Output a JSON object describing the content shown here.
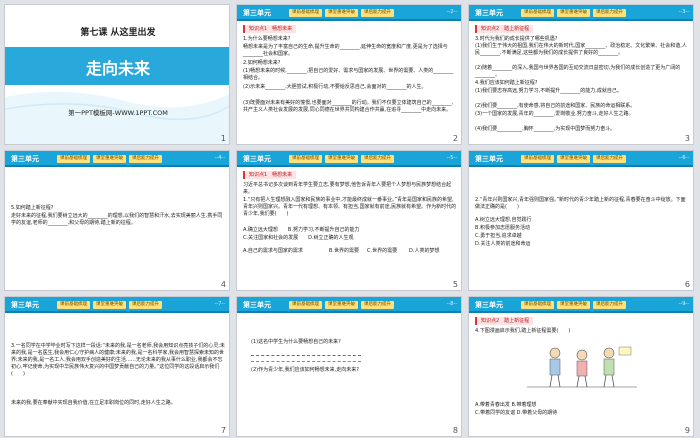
{
  "slides": [
    {
      "num": "1",
      "chapter_title": "第七课 从这里出发",
      "main_title": "走向未来",
      "brand": "第一PPT模板网-WWW.1PPT.COM"
    },
    {
      "num": "2",
      "unit": "第三单元",
      "tabs": [
        "课前基础梳理",
        "课堂重难突破",
        "课后能力提升"
      ],
      "page": "--2--",
      "section": "知识点1　畅想未来",
      "lines": [
        "1.为什么要畅想未来?",
        "畅想未来是为了丰富自己的生命,提升生命的________,延伸生命的宽度和广度,更是为了选择与________社会和国家。",
        "2.如何畅想未来?",
        "(1)畅想未来的时候,________,把自己的爱好、需求与国家的发展、世界的需要、人类的________相结合。",
        "(2)示未来________,大胆尝试,积极行动,不要给反思自己,会面对的________的人生。",
        "(3)既要面对未来有美好的憧憬,也要面对________的行动。我们不仅要立体建筑自己的________,共产主义人类社会发展的发展,同心同德在世界共同构建合作共赢,在追寻________中走向未来。"
      ]
    },
    {
      "num": "3",
      "unit": "第三单元",
      "tabs": [
        "课前基础梳理",
        "课堂重难突破",
        "课后能力提升"
      ],
      "page": "--3--",
      "section": "知识点2　踏上新征程",
      "lines": [
        "3.时代为我们的成长提供了哪些机遇?",
        "(1)我们生于伟大的祖国,我们在伟大的新时代,国家________、政治稳定、文化繁荣、社会和谐,人民________,不断满足,这些都为我们的成长提供了良好的________。",
        "(2)随着________的深入,我国与世界各国的互动交流日益密切,为我们的成长创造了更为广阔的________。",
        "4.我们应该如何踏上新征程?",
        "(1)我们要志存高远,努力学习,不断提升________的能力,成就自己。",
        "(2)我们要________,有使命感,将自己的前途和国家、民族的命运相联系。",
        "(3)一个国家的发展,青年的________,爱岗敬业,努力奋斗,走好人生之路。",
        "(4)我们要__________,胸怀________,为实现中国梦而努力奋斗。"
      ]
    },
    {
      "num": "4",
      "unit": "第三单元",
      "tabs": [
        "课前基础梳理",
        "课堂重难突破",
        "课后能力提升"
      ],
      "page": "--4--",
      "lines": [
        "5.如何踏上新征程?",
        "走好未来的征程,我们要树立远大的________的理想,以我们的智慧和汗水,去实现美丽人生,携手同学的友谊,老师的________,和父母的期待,踏上新的征程。"
      ]
    },
    {
      "num": "5",
      "unit": "第三单元",
      "tabs": [
        "课前基础梳理",
        "课堂重难突破",
        "课后能力提升"
      ],
      "page": "--5--",
      "section": "知识点1　畅想未来",
      "lines": [
        "习近平总书记多次谈到青年学生要立志,要有梦想,他告诉青年人要把个人梦想与民族梦想结合起来。",
        "1.“只有把人生理想融入国家和民族的事业中,才能最终成就一番事业。”青年是国家和民族的希望,青年兴则国家兴。青年一代有理想、有本领、有担当,国家就有前途,民族就有希望。作为新时代的青少年,我们要(　　)",
        "A.确立远大理想　　B.努力学习,不断提升自己的能力",
        "C.关注国家和社会的发展　　D.树立正确的人生观"
      ],
      "options": [
        "A.自己的需求与国家的需求",
        "B.世界的需要",
        "C.世界的需要",
        "D.人类的梦想"
      ]
    },
    {
      "num": "6",
      "unit": "第三单元",
      "tabs": [
        "课前基础梳理",
        "课堂重难突破",
        "课后能力提升"
      ],
      "page": "--6--",
      "lines": [
        "2.“青年兴则国家兴,青年强则国家强。”新时代的青少年踏上新的征程,青春要在奋斗中绽放。下面做法正确的是(　　)",
        "A.树立远大理想,自觉践行",
        "B.积极参加志愿服务活动",
        "C.勇于担当,追求卓越",
        "D.关注人类的前途和命运"
      ]
    },
    {
      "num": "7",
      "unit": "第三单元",
      "tabs": [
        "课前基础梳理",
        "课堂重难突破",
        "课后能力提升"
      ],
      "page": "--7--",
      "lines": [
        "3.一名同学在中学毕业时写下这样一段话:“未来的我,是一名老师,我会用知识点亮孩子们的心灵;未来的我,是一名医生,我会用仁心守护病人的健康;未来的我,是一名科学家,我会用智慧探索未知的世界;未来的我,是一名工人,我会用双手创造美好的生活……无论未来的我从事什么职业,我都会不忘初心,牢记使命,为实现中华民族伟大复兴的中国梦贡献自己的力量。”这位同学的这段话启示我们(　　)",
        "未来的我,要在奉献中实现自我价值,在立足本职岗位的同时,走好人生之路。"
      ]
    },
    {
      "num": "8",
      "unit": "第三单元",
      "tabs": [
        "课前基础梳理",
        "课堂重难突破",
        "课后能力提升"
      ],
      "page": "--8--",
      "lines": [
        "(1)这名中学生为什么要畅想自己的未来?",
        "(2)作为青少年,我们应该如何畅想未来,走向未来?"
      ]
    },
    {
      "num": "9",
      "unit": "第三单元",
      "tabs": [
        "课前基础梳理",
        "课堂重难突破",
        "课后能力提升"
      ],
      "page": "--9--",
      "section": "知识点2　踏上新征程",
      "lines": [
        "4.下图漫画启示我们,踏上新征程需要(　　)"
      ],
      "options": [
        "A.带着青春出发  B.带着理想",
        "C.带着同学的友谊  D.带着父母的期待"
      ]
    }
  ],
  "colors": {
    "header": "#1aa5d8",
    "accent": "#d33",
    "title_bar": "#29a8dc"
  }
}
